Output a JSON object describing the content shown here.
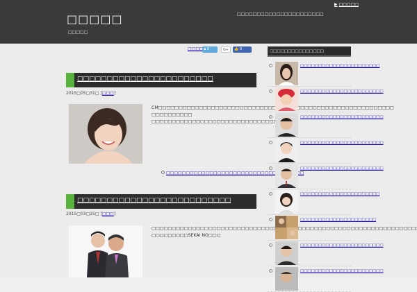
{
  "header": {
    "site_title": "□□□□□",
    "site_desc": "□□□□□",
    "tagline": "□□□□□□□□□□□□□□□□□□□□□□",
    "top_link": "□□□□□"
  },
  "share": {
    "label": "□□□□",
    "twitter_count": "0",
    "gplus": "G+",
    "fb_like": "0"
  },
  "posts": [
    {
      "title": "□□□□□□□□□□□□□□□□□□□□□□□",
      "date": "2015□05□31□ [",
      "category": "□□□",
      "date_end": "]",
      "excerpt": "CM□□□□□□□□□□□□□□□□□□□□□□□□□□□□□□□□□□□□□□□□□□□□□□□□□□□□□□□□□□ □□□□□□□□□□ □□□□□□□□□□□□□□□□□□□□□□□□□□□□□□□□□□",
      "readmore": "□□□□□□□□□□□□□□□□□□□□□□□□□□□□□□□□□□□"
    },
    {
      "title": "□□□□□□□□□□□□□□□□□□□□□□□□□□",
      "date": "2015□03□25□ [",
      "category": "□□□",
      "date_end": "]",
      "excerpt": "□□□□□□□□□□□□□□□□□□□□□□□□□□□□□□□□□□□□□□□□□□□□□□□□□□□□□□□□□□□□□□□□□□ □□□□□□□□□SEKAI NO□□□"
    }
  ],
  "sidebar": {
    "heading": "□□□□□□□□□□□□□□□",
    "items": [
      {
        "title": "□□□□□□□□□□□□□□□□□□□□□□"
      },
      {
        "title": "□□□□□□□□□□□□□□□□□□□□□□□"
      },
      {
        "title": "□□□□□□□□□□□□□□□□□□□□□□□"
      },
      {
        "title": "□□□□□□□□□□□□□□□□□□□□□□□"
      },
      {
        "title": "□□□□□□□□□□□□□□□□□□□□□□□"
      },
      {
        "title": "□□□□□□□□□□□□□□□□□□□□□□"
      },
      {
        "title": "□□□□□□□□□□□□□□□□□□□□□"
      },
      {
        "title": "□□□□□□□□□□□□□□□□□□□□□□□"
      },
      {
        "title": "□□□□□□□□□□□□□□□□□□□□□□□"
      }
    ]
  }
}
